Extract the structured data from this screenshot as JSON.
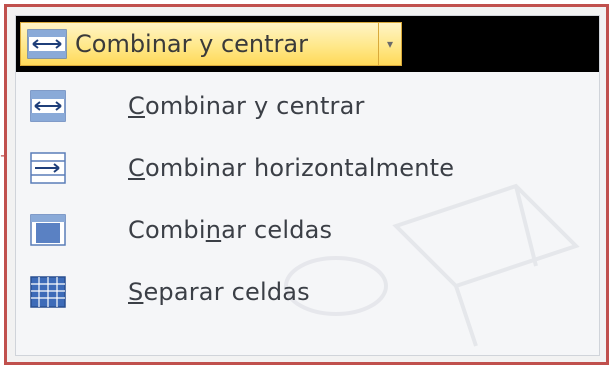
{
  "toolbar": {
    "split_button_label": "Combinar y centrar",
    "icon": "merge-center-icon",
    "dropdown_icon": "chevron-down-icon"
  },
  "menu": {
    "items": [
      {
        "pre": "",
        "accel": "C",
        "post": "ombinar y centrar",
        "icon": "merge-center-icon"
      },
      {
        "pre": "",
        "accel": "C",
        "post": "ombinar horizontalmente",
        "icon": "merge-across-icon"
      },
      {
        "pre": "Combi",
        "accel": "n",
        "post": "ar celdas",
        "icon": "merge-cells-icon"
      },
      {
        "pre": "",
        "accel": "S",
        "post": "eparar celdas",
        "icon": "unmerge-cells-icon"
      }
    ]
  },
  "colors": {
    "frame_border": "#c0504d",
    "button_hover": "#ffe88a",
    "icon_blue": "#3d6bb8"
  }
}
